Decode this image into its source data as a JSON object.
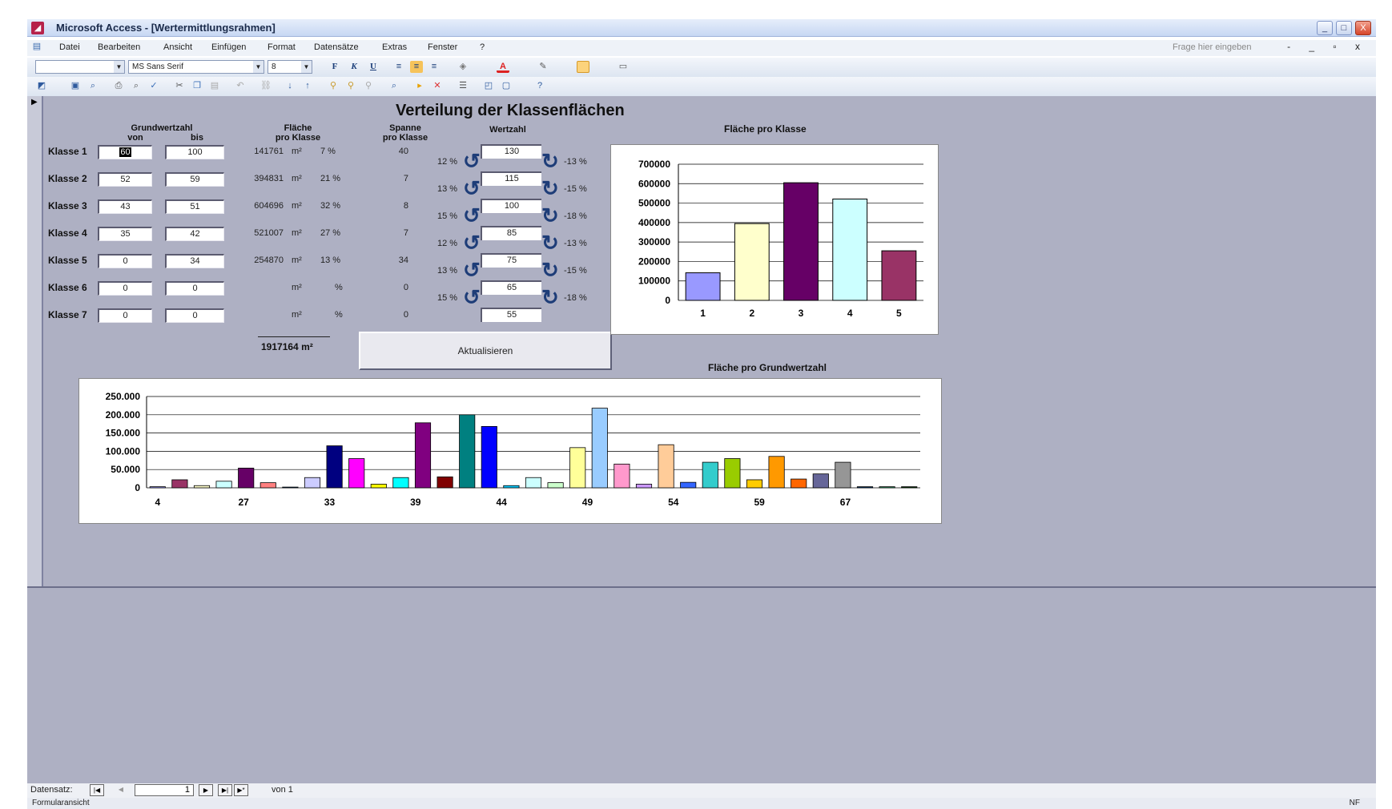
{
  "window": {
    "title": "Microsoft Access - [Wertermittlungsrahmen]",
    "buttons": [
      "_",
      "□",
      "X"
    ]
  },
  "menu": {
    "items": [
      "Datei",
      "Bearbeiten",
      "Ansicht",
      "Einfügen",
      "Format",
      "Datensätze",
      "Extras",
      "Fenster",
      "?"
    ],
    "help_placeholder": "Frage hier eingeben",
    "mdi_controls": "- _ ▫ x"
  },
  "format_toolbar": {
    "object_combo": "",
    "font": "MS Sans Serif",
    "size": "8",
    "bold": "F",
    "italic": "K",
    "underline": "U"
  },
  "form": {
    "heading": "Verteilung der Klassenflächen",
    "col_grundwertzahl": "Grundwertzahl",
    "col_von": "von",
    "col_bis": "bis",
    "col_flaeche": "Fläche",
    "col_flaeche_sub": "pro Klasse",
    "col_spanne": "Spanne",
    "col_spanne_sub": "pro Klasse",
    "col_wertzahl": "Wertzahl",
    "unit": "m²",
    "percent_sign": "%",
    "classes": [
      {
        "label": "Klasse 1",
        "von": "60",
        "bis": "100",
        "flaeche": "141761",
        "anteil": "7 %",
        "spanne": "40"
      },
      {
        "label": "Klasse 2",
        "von": "52",
        "bis": "59",
        "flaeche": "394831",
        "anteil": "21 %",
        "spanne": "7"
      },
      {
        "label": "Klasse 3",
        "von": "43",
        "bis": "51",
        "flaeche": "604696",
        "anteil": "32 %",
        "spanne": "8"
      },
      {
        "label": "Klasse 4",
        "von": "35",
        "bis": "42",
        "flaeche": "521007",
        "anteil": "27 %",
        "spanne": "7"
      },
      {
        "label": "Klasse 5",
        "von": "0",
        "bis": "34",
        "flaeche": "254870",
        "anteil": "13 %",
        "spanne": "34"
      },
      {
        "label": "Klasse 6",
        "von": "0",
        "bis": "0",
        "flaeche": "",
        "anteil": "%",
        "spanne": "0"
      },
      {
        "label": "Klasse 7",
        "von": "0",
        "bis": "0",
        "flaeche": "",
        "anteil": "%",
        "spanne": "0"
      }
    ],
    "total": "1917164",
    "wertzahlen": [
      "130",
      "115",
      "100",
      "85",
      "75",
      "65",
      "55"
    ],
    "left_pcts": [
      "12 %",
      "13 %",
      "15 %",
      "12 %",
      "13 %",
      "15 %"
    ],
    "right_pcts": [
      "-13 %",
      "-15 %",
      "-18 %",
      "-13 %",
      "-15 %",
      "-18 %"
    ],
    "update_button": "Aktualisieren"
  },
  "chart_data": [
    {
      "type": "bar",
      "title": "Fläche pro Klasse",
      "categories": [
        "1",
        "2",
        "3",
        "4",
        "5"
      ],
      "values": [
        141761,
        394831,
        604696,
        521007,
        254870
      ],
      "ylim": [
        0,
        700000
      ],
      "yticks": [
        "700000",
        "600000",
        "500000",
        "400000",
        "300000",
        "200000",
        "100000",
        "0"
      ],
      "colors": [
        "#9999ff",
        "#ffffcc",
        "#660066",
        "#ccffff",
        "#993366"
      ],
      "grid": true
    },
    {
      "type": "bar",
      "title": "Fläche pro Grundwertzahl",
      "values": [
        3000,
        22000,
        6000,
        18000,
        54000,
        14000,
        2000,
        28000,
        115000,
        80000,
        10000,
        28000,
        178000,
        30000,
        200000,
        168000,
        6000,
        28000,
        14000,
        110000,
        218000,
        65000,
        10000,
        118000,
        15000,
        70000,
        80000,
        22000,
        86000,
        24000,
        38000,
        70000,
        3000,
        3000,
        3000
      ],
      "tick_labels": [
        "4",
        "27",
        "33",
        "39",
        "44",
        "49",
        "54",
        "59",
        "67"
      ],
      "ylim": [
        0,
        250000
      ],
      "yticks": [
        "250.000",
        "200.000",
        "150.000",
        "100.000",
        "50.000",
        "0"
      ],
      "colors": [
        "#9999ff",
        "#993366",
        "#ffffcc",
        "#ccffff",
        "#660066",
        "#ff8080",
        "#0066cc",
        "#ccccff",
        "#000080",
        "#ff00ff",
        "#ffff00",
        "#00ffff",
        "#800080",
        "#800000",
        "#008080",
        "#0000ff",
        "#00ccff",
        "#ccffff",
        "#ccffcc",
        "#ffff99",
        "#99ccff",
        "#ff99cc",
        "#cc99ff",
        "#ffcc99",
        "#3366ff",
        "#33cccc",
        "#99cc00",
        "#ffcc00",
        "#ff9900",
        "#ff6600",
        "#666699",
        "#969696",
        "#003366",
        "#339966",
        "#003300"
      ],
      "grid": true
    }
  ],
  "navigation": {
    "label": "Datensatz:",
    "current": "1",
    "of_text": "von 1"
  },
  "status": {
    "view": "Formularansicht",
    "indicator": "NF"
  }
}
